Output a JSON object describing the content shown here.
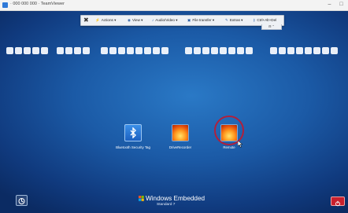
{
  "window": {
    "title": "· 000 000 000 · TeamViewer",
    "minimize": "–",
    "maximize": "□",
    "close": "✕"
  },
  "toolbar": {
    "close": "✖",
    "actions": "Actions ▾",
    "view": "View ▾",
    "audio_video": "Audio/Video ▾",
    "file_transfer": "File transfer ▾",
    "extras": "Extras ▾",
    "ctrl_alt_del": "Ctrl+Alt+Del",
    "tab": "⊟ ⌃"
  },
  "desktop_icons": [
    {
      "label": "Bluetooth Security Tag"
    },
    {
      "label": "DriveRecorder"
    },
    {
      "label": "Remote"
    }
  ],
  "brand": {
    "name": "Windows Embedded",
    "edition": "Standard 7"
  },
  "colors": {
    "desktop_blue": "#1b5aa6",
    "highlight_circle": "#b0203c",
    "power_button": "#c8202d"
  }
}
